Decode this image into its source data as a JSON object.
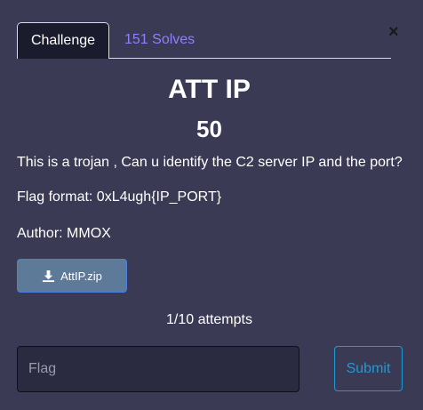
{
  "tabs": {
    "challenge_label": "Challenge",
    "solves_label": "151 Solves"
  },
  "close_symbol": "×",
  "challenge": {
    "title": "ATT IP",
    "points": "50",
    "description": "This is a trojan , Can u identify the C2 server IP and the port?",
    "flag_format": "Flag format: 0xL4ugh{IP_PORT}",
    "author": "Author: MMOX"
  },
  "file": {
    "label": "AttIP.zip",
    "icon": "download-icon"
  },
  "attempts": "1/10 attempts",
  "form": {
    "flag_placeholder": "Flag",
    "flag_value": "",
    "submit_label": "Submit"
  },
  "colors": {
    "background": "#3b3a54",
    "solves_link": "#8f7fff",
    "submit_accent": "#1d9ad6",
    "file_button": "#5d7a99"
  }
}
